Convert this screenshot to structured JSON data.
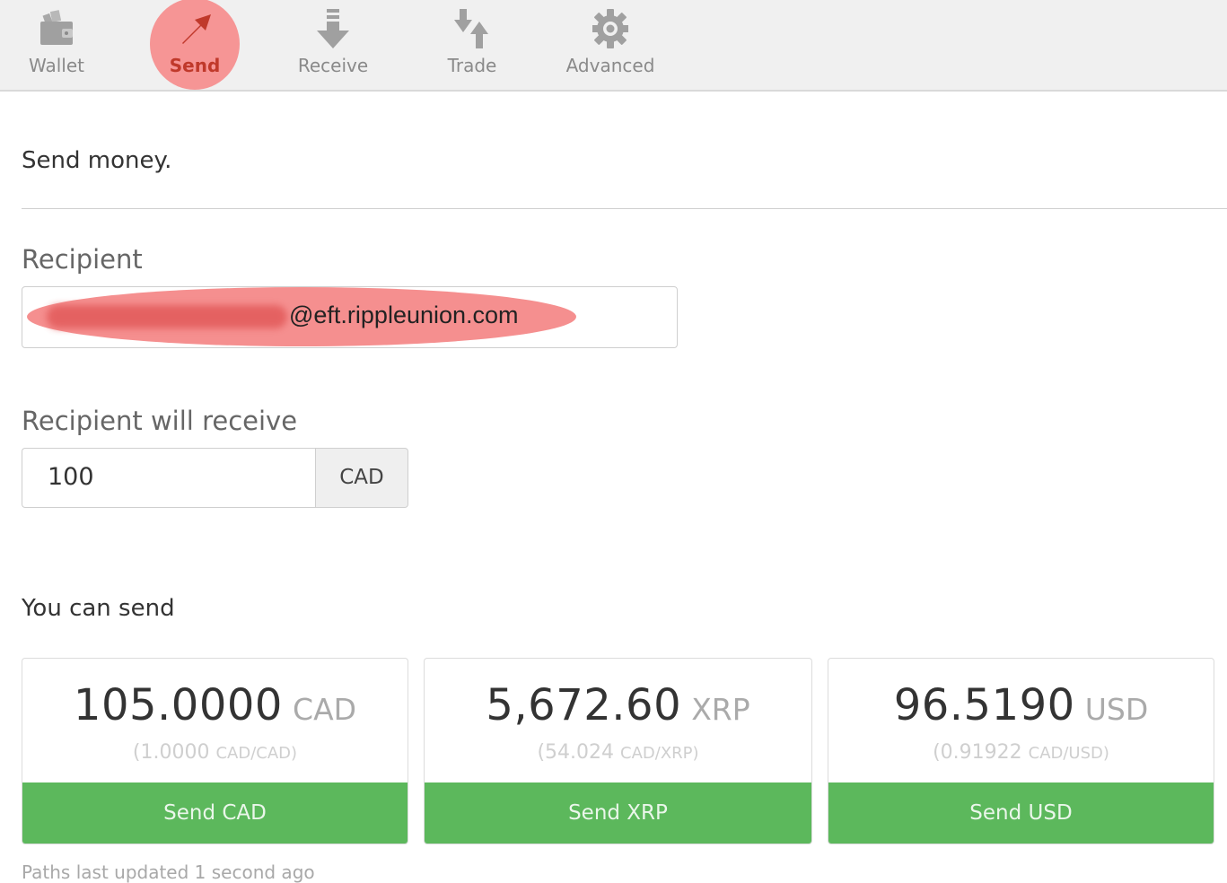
{
  "nav": {
    "items": [
      {
        "label": "Wallet",
        "icon": "wallet-icon"
      },
      {
        "label": "Send",
        "icon": "send-arrow-icon",
        "active": true
      },
      {
        "label": "Receive",
        "icon": "receive-arrow-icon"
      },
      {
        "label": "Trade",
        "icon": "trade-arrows-icon"
      },
      {
        "label": "Advanced",
        "icon": "gear-icon"
      }
    ],
    "active_color": "#c0392b",
    "highlight_color": "#f58f8f"
  },
  "page": {
    "title": "Send money.",
    "recipient_label": "Recipient",
    "recipient_value_visible": "@eft.rippleunion.com",
    "receive_label": "Recipient will receive",
    "amount_value": "100",
    "currency": "CAD",
    "send_heading": "You can send",
    "paths_updated": "Paths last updated 1 second ago"
  },
  "send_options": [
    {
      "amount": "105.0000",
      "currency": "CAD",
      "rate_value": "(1.0000",
      "rate_pair": "CAD/CAD)",
      "button": "Send CAD"
    },
    {
      "amount": "5,672.60",
      "currency": "XRP",
      "rate_value": "(54.024",
      "rate_pair": "CAD/XRP)",
      "button": "Send XRP"
    },
    {
      "amount": "96.5190",
      "currency": "USD",
      "rate_value": "(0.91922",
      "rate_pair": "CAD/USD)",
      "button": "Send USD"
    }
  ],
  "colors": {
    "send_button": "#5cb85c",
    "nav_background": "#f0f0f0"
  }
}
